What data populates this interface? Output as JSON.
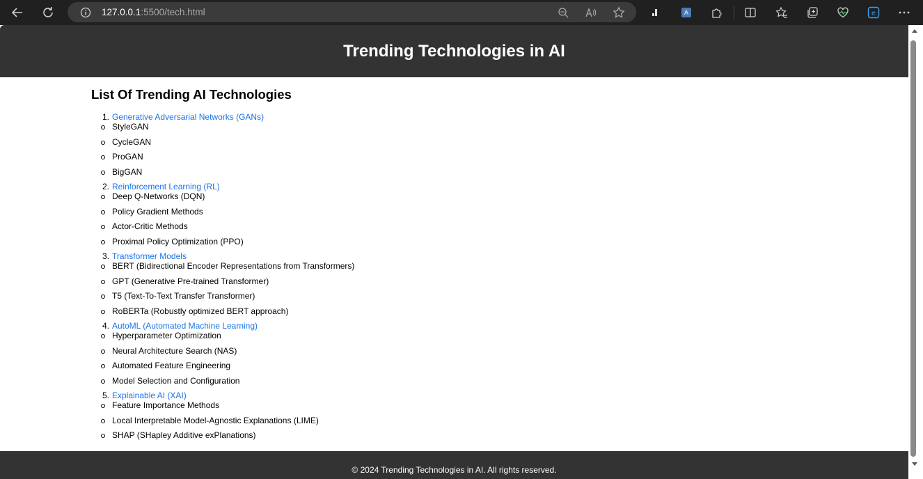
{
  "browser": {
    "url_host": "127.0.0.1",
    "url_rest": ":5500/tech.html",
    "icons": [
      "back-icon",
      "refresh-icon",
      "info-icon",
      "zoom-out-icon",
      "read-aloud-icon",
      "favorite-star-icon",
      "extension-bar-icon",
      "translate-extension-icon",
      "extensions-puzzle-icon",
      "split-screen-icon",
      "favorites-icon",
      "collections-icon",
      "browser-essentials-icon",
      "edge-icon",
      "more-menu-icon"
    ]
  },
  "header": {
    "title": "Trending Technologies in AI"
  },
  "main": {
    "heading": "List Of Trending AI Technologies",
    "technologies": [
      {
        "number": "1.",
        "name": "Generative Adversarial Networks (GANs)",
        "items": [
          "StyleGAN",
          "CycleGAN",
          "ProGAN",
          "BigGAN"
        ]
      },
      {
        "number": "2.",
        "name": "Reinforcement Learning (RL)",
        "items": [
          "Deep Q-Networks (DQN)",
          "Policy Gradient Methods",
          "Actor-Critic Methods",
          "Proximal Policy Optimization (PPO)"
        ]
      },
      {
        "number": "3.",
        "name": "Transformer Models",
        "items": [
          "BERT (Bidirectional Encoder Representations from Transformers)",
          "GPT (Generative Pre-trained Transformer)",
          "T5 (Text-To-Text Transfer Transformer)",
          "RoBERTa (Robustly optimized BERT approach)"
        ]
      },
      {
        "number": "4.",
        "name": "AutoML (Automated Machine Learning)",
        "items": [
          "Hyperparameter Optimization",
          "Neural Architecture Search (NAS)",
          "Automated Feature Engineering",
          "Model Selection and Configuration"
        ]
      },
      {
        "number": "5.",
        "name": "Explainable AI (XAI)",
        "items": [
          "Feature Importance Methods",
          "Local Interpretable Model-Agnostic Explanations (LIME)",
          "SHAP (SHapley Additive exPlanations)"
        ]
      }
    ]
  },
  "footer": {
    "text": "© 2024 Trending Technologies in AI. All rights reserved."
  },
  "colors": {
    "header_bg": "#333333",
    "link": "#1a73e8",
    "chrome_bg": "#202020"
  }
}
